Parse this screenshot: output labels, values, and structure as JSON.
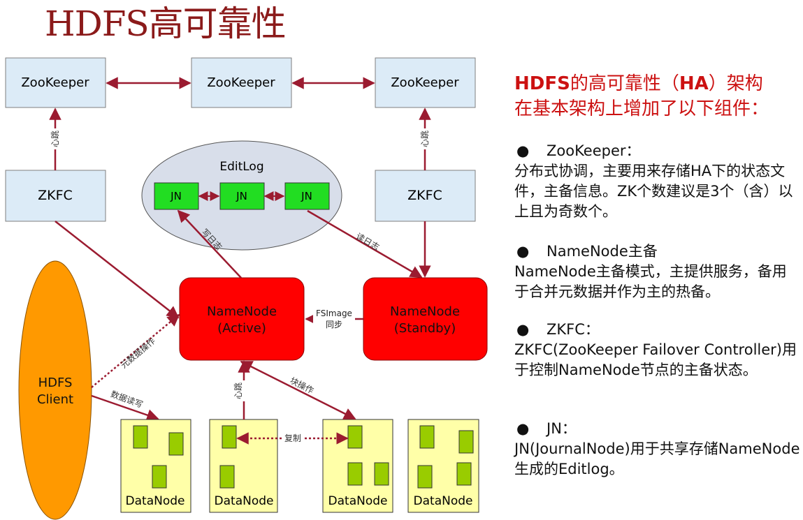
{
  "title": "HDFS高可靠性",
  "colors": {
    "title": "#8B1A1A",
    "arrow": "#9B1B30",
    "zookeeper_fill": "#DCEBF7",
    "namenode_fill": "#FF0000",
    "jn_fill": "#22DD22",
    "editlog_fill": "#D8DEEA",
    "datanode_fill": "#FFFFA8",
    "block_fill": "#99CC00",
    "client_fill": "#FF9900",
    "heading_red": "#CC1111"
  },
  "diagram": {
    "zookeepers": [
      "ZooKeeper",
      "ZooKeeper",
      "ZooKeeper"
    ],
    "zkfc_left": "ZKFC",
    "zkfc_right": "ZKFC",
    "heartbeat_left": "心跳",
    "heartbeat_right": "心跳",
    "editlog_label": "EditLog",
    "jn_nodes": [
      "JN",
      "JN",
      "JN"
    ],
    "write_log": "写日志",
    "read_log": "读日志",
    "namenode_active": {
      "line1": "NameNode",
      "line2": "(Active)"
    },
    "namenode_standby": {
      "line1": "NameNode",
      "line2": "(Standby)"
    },
    "fsimage_sync": {
      "line1": "FSImage",
      "line2": "同步"
    },
    "client": {
      "line1": "HDFS",
      "line2": "Client"
    },
    "metadata_op": "元数据操作",
    "data_rw": "数据读写",
    "heartbeat_dn": "心跳",
    "block_op": "块操作",
    "replicate": "复制",
    "datanodes": [
      "DataNode",
      "DataNode",
      "DataNode",
      "DataNode"
    ]
  },
  "sidebar": {
    "heading_bold1": "HDFS",
    "heading_mid": "的高可靠性（",
    "heading_bold2": "HA",
    "heading_end": "）架构",
    "heading_line2": "在基本架构上增加了以下组件：",
    "bullet_symbol": "●",
    "items": [
      {
        "title": "ZooKeeper：",
        "body": "分布式协调，主要用来存储HA下的状态文件，主备信息。ZK个数建议是3个（含）以上且为奇数个。"
      },
      {
        "title": "NameNode主备",
        "body": "NameNode主备模式，主提供服务，备用于合并元数据并作为主的热备。"
      },
      {
        "title": "ZKFC：",
        "body": "ZKFC(ZooKeeper Failover Controller)用于控制NameNode节点的主备状态。"
      },
      {
        "title": "JN：",
        "body": "JN(JournalNode)用于共享存储NameNode生成的Editlog。"
      }
    ]
  }
}
